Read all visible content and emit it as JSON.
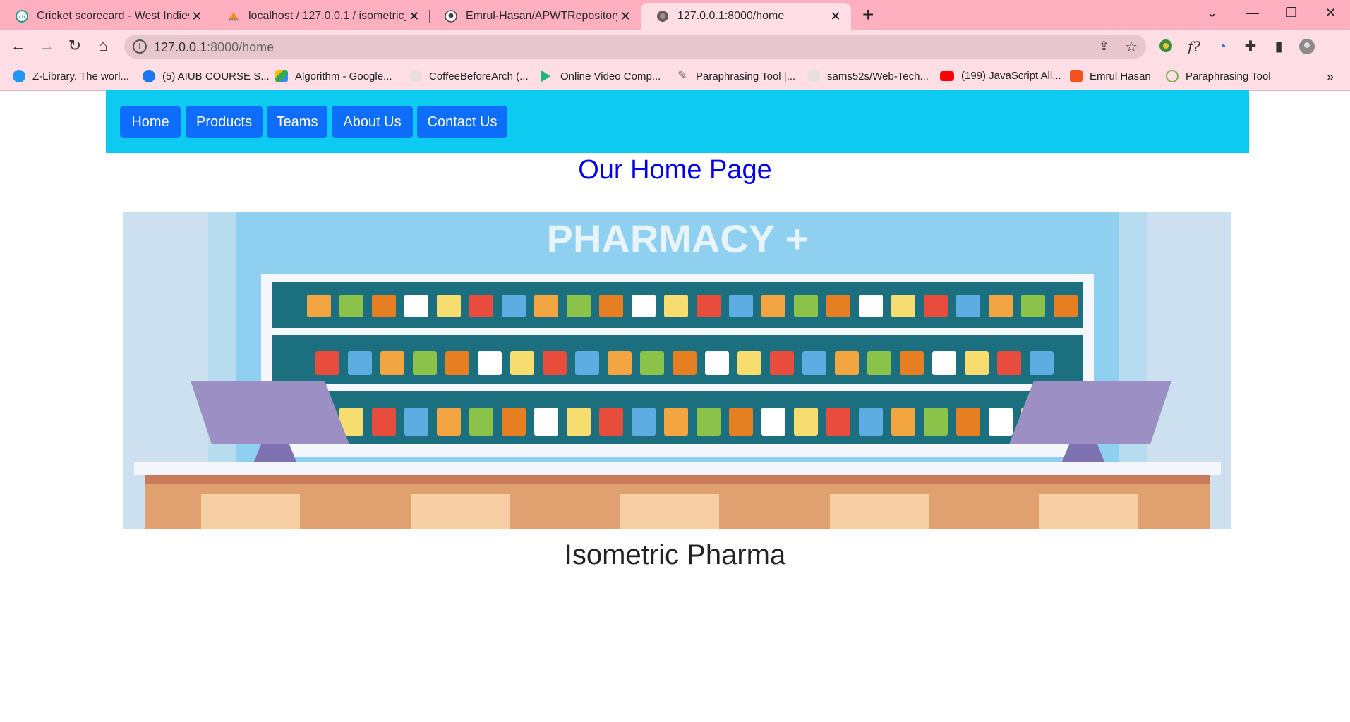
{
  "browser": {
    "tabs": [
      {
        "title": "Cricket scorecard - West Indies v",
        "active": false
      },
      {
        "title": "localhost / 127.0.0.1 / isometric_p",
        "active": false
      },
      {
        "title": "Emrul-Hasan/APWTRepository",
        "active": false
      },
      {
        "title": "127.0.0.1:8000/home",
        "active": true
      }
    ],
    "url_host": "127.0.0.1",
    "url_path": ":8000/home",
    "bookmarks": [
      {
        "label": "Z-Library. The worl...",
        "color": "#2196f3"
      },
      {
        "label": "(5) AIUB COURSE S...",
        "color": "#1877f2"
      },
      {
        "label": "Algorithm - Google...",
        "color": "#34a853"
      },
      {
        "label": "CoffeeBeforeArch (...",
        "color": "#cccccc"
      },
      {
        "label": "Online Video Comp...",
        "color": "#1eb980"
      },
      {
        "label": "Paraphrasing Tool |...",
        "color": "#888888"
      },
      {
        "label": "sams52s/Web-Tech...",
        "color": "#cccccc"
      },
      {
        "label": "(199) JavaScript All...",
        "color": "#ff0000"
      },
      {
        "label": "Emrul Hasan",
        "color": "#f4511e"
      },
      {
        "label": "Paraphrasing Tool",
        "color": "#7cb342"
      }
    ]
  },
  "nav": {
    "items": [
      "Home",
      "Products",
      "Teams",
      "About Us",
      "Contact Us"
    ]
  },
  "page": {
    "heading": "Our Home Page",
    "hero_sign": "PHARMACY +",
    "caption": "Isometric Pharma"
  },
  "colors": {
    "navbar_bg": "#0dcaf0",
    "nav_button_bg": "#0d6efd",
    "heading": "#0000ee"
  }
}
